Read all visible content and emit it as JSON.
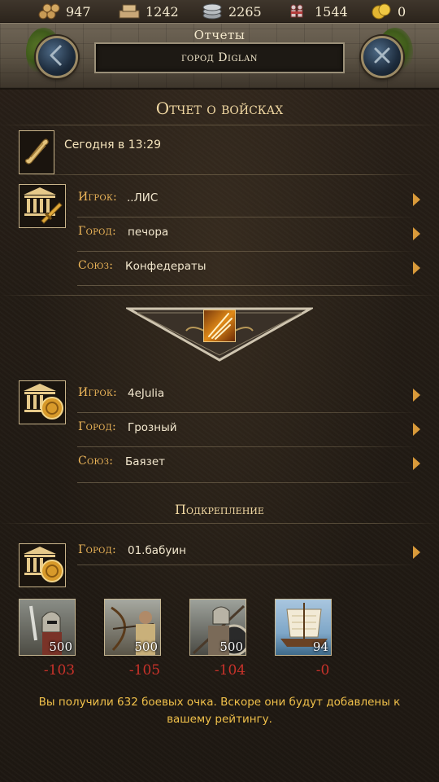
{
  "resources": [
    {
      "name": "wood-icon",
      "value": "947"
    },
    {
      "name": "stone-icon",
      "value": "1242"
    },
    {
      "name": "iron-icon",
      "value": "2265"
    },
    {
      "name": "population-icon",
      "value": "1544"
    },
    {
      "name": "gold-icon",
      "value": "0"
    }
  ],
  "header": {
    "title": "Отчеты",
    "subtitle": "город Diglan",
    "back_icon": "back-arrow-icon",
    "close_icon": "close-icon"
  },
  "report": {
    "title": "Отчет о войсках",
    "time": "Сегодня в 13:29"
  },
  "attacker": {
    "player_label": "Игрок:",
    "player_value": "..ЛИС",
    "city_label": "Город:",
    "city_value": "печора",
    "alliance_label": "Союз:",
    "alliance_value": "Конфедераты"
  },
  "defender": {
    "player_label": "Игрок:",
    "player_value": "4eJulia",
    "city_label": "Город:",
    "city_value": "Грозный",
    "alliance_label": "Союз:",
    "alliance_value": "Баязет"
  },
  "reinforcement": {
    "title": "Подкрепление",
    "city_label": "Город:",
    "city_value": "01.бабуин",
    "units": [
      {
        "type": "swordsman",
        "count": "500",
        "loss": "-103"
      },
      {
        "type": "archer",
        "count": "500",
        "loss": "-105"
      },
      {
        "type": "hoplite",
        "count": "500",
        "loss": "-104"
      },
      {
        "type": "ship",
        "count": "94",
        "loss": "-0"
      }
    ]
  },
  "footer": {
    "message": "Вы получили 632 боевых очка. Вскоре они будут добавлены к вашему рейтингу."
  },
  "colors": {
    "label_orange": "#f0b85a",
    "loss_red": "#c8322a",
    "footer_gold": "#f0c04a",
    "arrow": "#d99a3a"
  }
}
